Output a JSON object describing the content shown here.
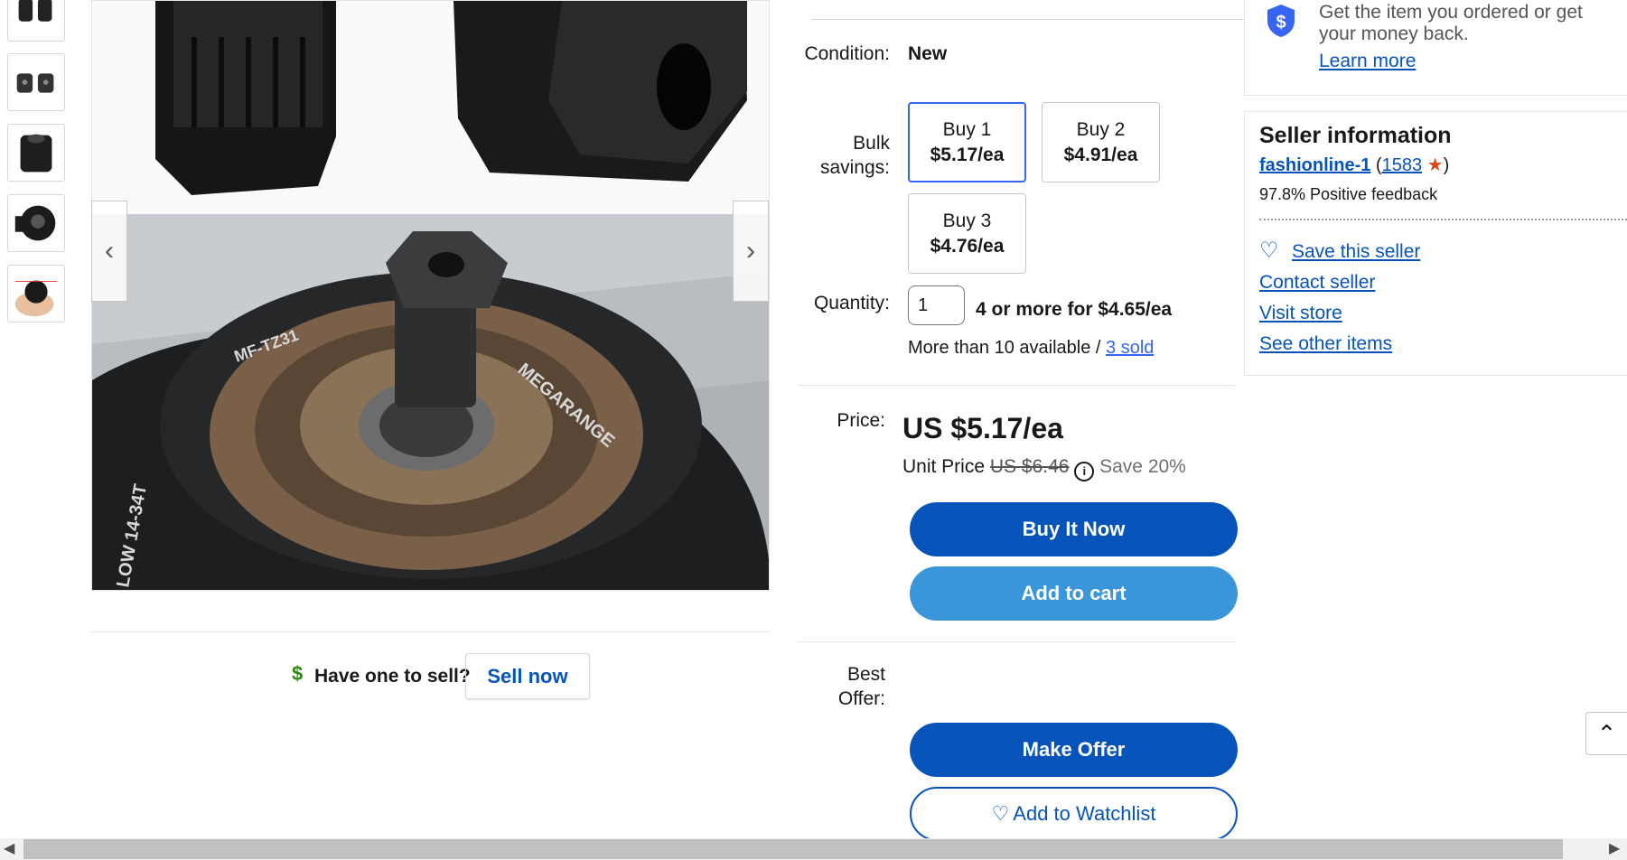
{
  "thumbnails": [
    {
      "name": "thumb-1",
      "icon": "hex-sockets-icon"
    },
    {
      "name": "thumb-2",
      "icon": "hex-sockets-icon"
    },
    {
      "name": "thumb-3",
      "icon": "socket-side-icon"
    },
    {
      "name": "thumb-4",
      "icon": "socket-round-icon"
    },
    {
      "name": "thumb-5",
      "icon": "hand-holding-icon"
    }
  ],
  "sell_section": {
    "question": "Have one to sell?",
    "button": "Sell now"
  },
  "condition": {
    "label": "Condition:",
    "value": "New"
  },
  "bulk": {
    "label_line1": "Bulk",
    "label_line2": "savings:",
    "options": [
      {
        "qty": "Buy 1",
        "price": "$5.17/ea",
        "selected": true
      },
      {
        "qty": "Buy 2",
        "price": "$4.91/ea",
        "selected": false
      },
      {
        "qty": "Buy 3",
        "price": "$4.76/ea",
        "selected": false
      }
    ]
  },
  "quantity": {
    "label": "Quantity:",
    "value": "1",
    "deal": "4 or more for $4.65/ea",
    "available": "More than 10 available / ",
    "sold": "3 sold"
  },
  "price": {
    "label": "Price:",
    "main": "US $5.17/ea",
    "unit_label": "Unit Price",
    "original": "US $6.46",
    "save": "Save 20%"
  },
  "buttons": {
    "buy_now": "Buy It Now",
    "add_to_cart": "Add to cart",
    "make_offer": "Make Offer",
    "watchlist": "Add to Watchlist"
  },
  "best_offer": {
    "line1": "Best",
    "line2": "Offer:"
  },
  "guarantee": {
    "text_line1": "Get the item you ordered or get",
    "text_line2": "your money back.",
    "link": "Learn more"
  },
  "seller": {
    "title": "Seller information",
    "name": "fashionline-1",
    "score": "1583",
    "feedback": "97.8% Positive feedback",
    "save": "Save this seller",
    "contact": "Contact seller",
    "visit": "Visit store",
    "other": "See other items"
  },
  "colors": {
    "primary": "#0654ba",
    "secondary": "#3a96d8",
    "link": "#3665f3",
    "star": "#e0481c"
  }
}
